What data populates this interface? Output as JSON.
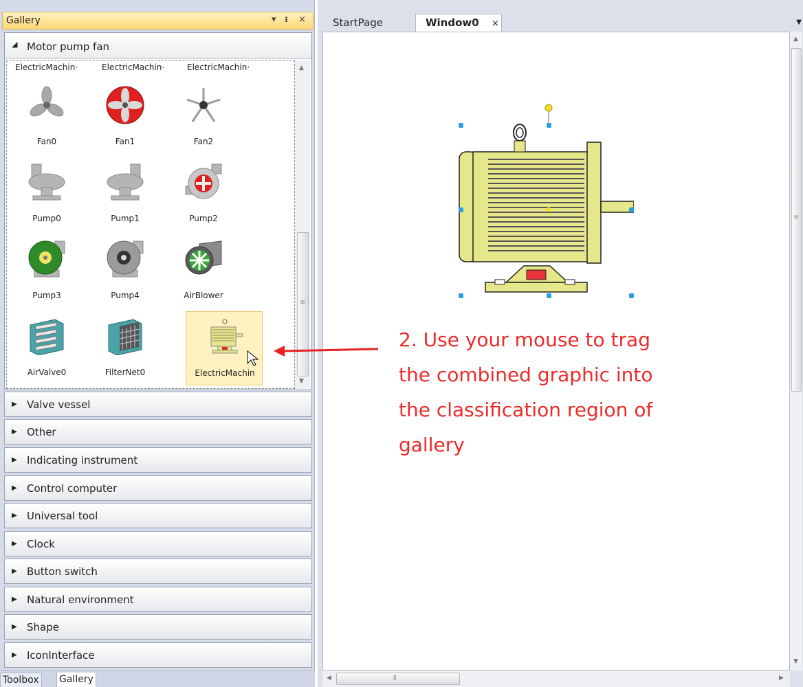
{
  "gallery": {
    "title": "Gallery",
    "controls": {
      "dropdown": "▾",
      "pin": "ᵻ",
      "close": "×"
    },
    "motor_group": {
      "label": "Motor pump fan",
      "cutoff_labels": [
        "ElectricMachin·",
        "ElectricMachin·",
        "ElectricMachin·"
      ],
      "items": [
        {
          "label": "Fan0",
          "icon": "fan-gray-icon"
        },
        {
          "label": "Fan1",
          "icon": "fan-red-icon"
        },
        {
          "label": "Fan2",
          "icon": "fan-spoke-icon"
        },
        {
          "label": "Pump0",
          "icon": "pump-gray-icon"
        },
        {
          "label": "Pump1",
          "icon": "pump-gray-icon"
        },
        {
          "label": "Pump2",
          "icon": "pump-red-icon"
        },
        {
          "label": "Pump3",
          "icon": "pump-green-icon"
        },
        {
          "label": "Pump4",
          "icon": "pump-dark-icon"
        },
        {
          "label": "AirBlower",
          "icon": "air-blower-icon"
        },
        {
          "label": "AirValve0",
          "icon": "air-valve-icon"
        },
        {
          "label": "FilterNet0",
          "icon": "filter-net-icon"
        },
        {
          "label": "ElectricMachin",
          "icon": "electric-machine-icon"
        }
      ]
    },
    "categories": [
      "Valve vessel",
      "Other",
      "Indicating instrument",
      "Control computer",
      "Universal tool",
      "Clock",
      "Button switch",
      "Natural environment",
      "Shape",
      "IconInterface"
    ]
  },
  "bottom_tabs": [
    "Toolbox",
    "Gallery"
  ],
  "editor": {
    "tabs": {
      "start": "StartPage",
      "window0": "Window0",
      "close": "×"
    },
    "instruction_lines": [
      "2. Use your mouse to trag",
      "the combined graphic into",
      "the classification region of",
      "gallery"
    ]
  },
  "colors": {
    "instruction": "#ee2a2a",
    "motor_body": "#e6e68a",
    "selection_handle": "#2a9fe0",
    "rotate_handle": "#f2e02a",
    "title_gradient": "#ffd775"
  }
}
